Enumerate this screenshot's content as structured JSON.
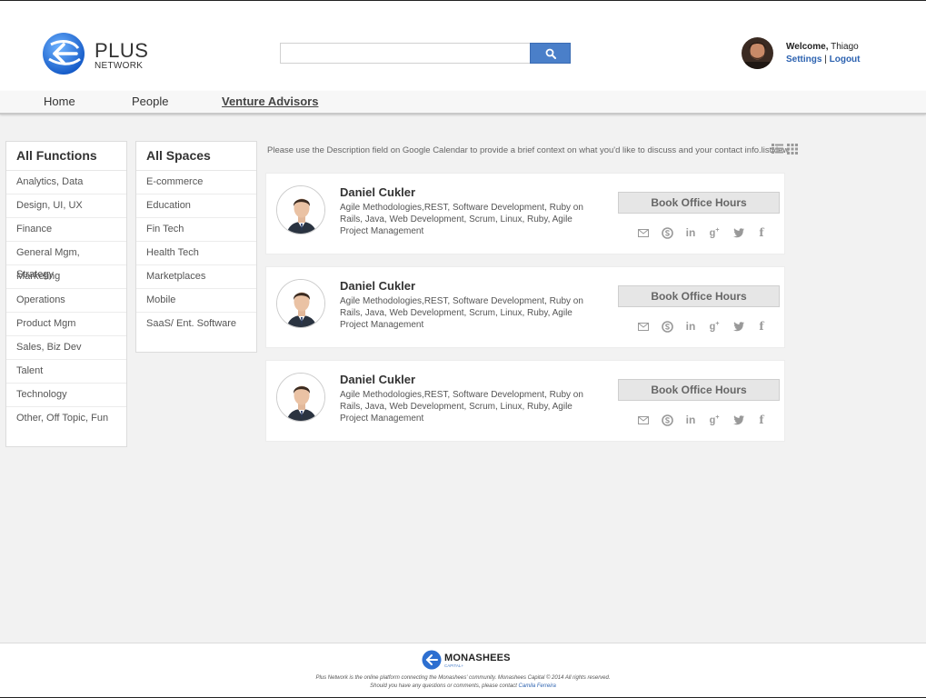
{
  "header": {
    "logo_title": "PLUS",
    "logo_subtitle": "NETWORK",
    "search_placeholder": "",
    "welcome_prefix": "Welcome,",
    "user_name": "Thiago",
    "settings_label": "Settings",
    "separator": "|",
    "logout_label": "Logout"
  },
  "nav": {
    "items": [
      "Home",
      "People",
      "Venture Advisors"
    ],
    "active": "Venture Advisors"
  },
  "functions": {
    "title": "All Functions",
    "items": [
      "Analytics, Data",
      "Design, UI, UX",
      "Finance",
      "General Mgm, Strategy",
      "Marketing",
      "Operations",
      "Product Mgm",
      "Sales, Biz Dev",
      "Talent",
      "Technology",
      "Other, Off Topic, Fun"
    ]
  },
  "spaces": {
    "title": "All Spaces",
    "items": [
      "E-commerce",
      "Education",
      "Fin Tech",
      "Health Tech",
      "Marketplaces",
      "Mobile",
      "SaaS/ Ent. Software"
    ]
  },
  "info_text": "Please use the Description field on Google Calendar to provide a brief context on what you'd like to discuss and your contact info.listview",
  "advisors": [
    {
      "name": "Daniel Cukler",
      "skills": "Agile Methodologies,REST, Software Development, Ruby on Rails, Java, Web Development, Scrum, Linux, Ruby, Agile Project Management",
      "button": "Book Office Hours"
    },
    {
      "name": "Daniel Cukler",
      "skills": "Agile Methodologies,REST, Software Development, Ruby on Rails, Java, Web Development, Scrum, Linux, Ruby, Agile Project Management",
      "button": "Book Office Hours"
    },
    {
      "name": "Daniel Cukler",
      "skills": "Agile Methodologies,REST, Software Development, Ruby on Rails, Java, Web Development, Scrum, Linux, Ruby, Agile Project Management",
      "button": "Book Office Hours"
    }
  ],
  "social_icons": [
    "mail-icon",
    "skype-icon",
    "linkedin-icon",
    "google-plus-icon",
    "twitter-icon",
    "facebook-icon"
  ],
  "footer": {
    "brand": "MONASHEES",
    "brand_sub": "CAPITAL+",
    "line1": "Plus Network is the online platform connecting the Monashees' community. Monashees Capital © 2014 All rights reserved.",
    "line2_prefix": "Should you have any questions or comments, please contact",
    "contact_name": "Camila Ferreira"
  },
  "colors": {
    "accent": "#4a7fc9",
    "link": "#2c62b0",
    "background": "#f2f2f2"
  }
}
